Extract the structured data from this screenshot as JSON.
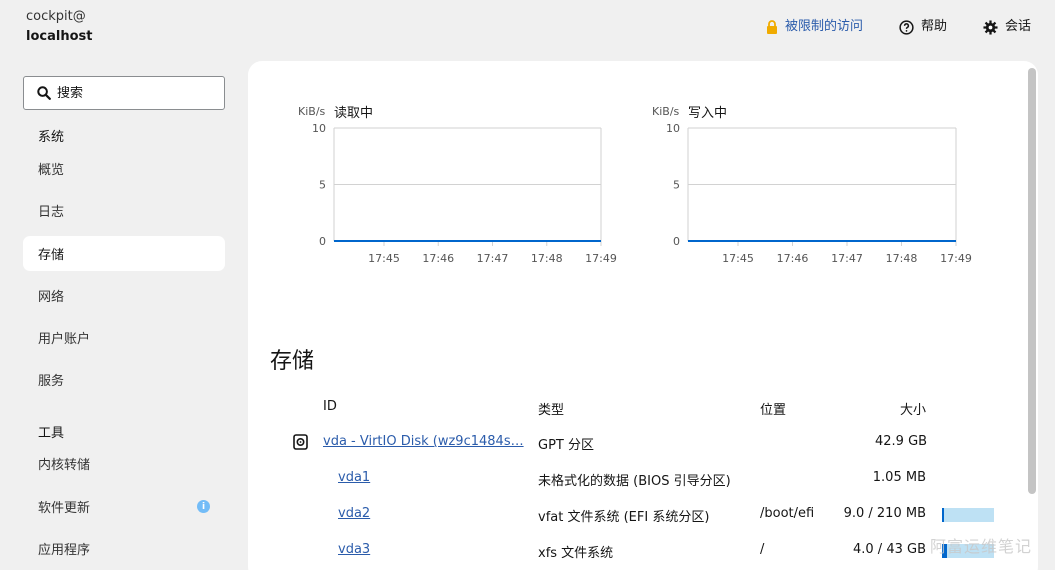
{
  "host": {
    "user": "cockpit@",
    "name": "localhost"
  },
  "topbar": {
    "limited_access": "被限制的访问",
    "help": "帮助",
    "session": "会话",
    "colors": {
      "link": "#2b5cab",
      "lock": "#f0ab00"
    }
  },
  "sidebar": {
    "search_placeholder": "搜索",
    "system_label": "系统",
    "system_items": [
      {
        "label": "概览"
      },
      {
        "label": "日志"
      },
      {
        "label": "存储"
      },
      {
        "label": "网络"
      },
      {
        "label": "用户账户"
      },
      {
        "label": "服务"
      }
    ],
    "tools_label": "工具",
    "tools_items": [
      {
        "label": "内核转储"
      },
      {
        "label": "软件更新"
      },
      {
        "label": "应用程序"
      }
    ],
    "active_item": "存储"
  },
  "charts": {
    "read": {
      "title": "读取中",
      "unit": "KiB/s"
    },
    "write": {
      "title": "写入中",
      "unit": "KiB/s"
    }
  },
  "chart_data": [
    {
      "type": "line",
      "title": "读取中",
      "ylabel": "KiB/s",
      "ylim": [
        0,
        10
      ],
      "y_ticks": [
        "10",
        "5",
        "0"
      ],
      "x": [
        "17:45",
        "17:46",
        "17:47",
        "17:48",
        "17:49"
      ],
      "values": [
        0,
        0,
        0,
        0,
        0
      ],
      "grid": true,
      "line_color": "#0066cc"
    },
    {
      "type": "line",
      "title": "写入中",
      "ylabel": "KiB/s",
      "ylim": [
        0,
        10
      ],
      "y_ticks": [
        "10",
        "5",
        "0"
      ],
      "x": [
        "17:45",
        "17:46",
        "17:47",
        "17:48",
        "17:49"
      ],
      "values": [
        0,
        0,
        0,
        0,
        0
      ],
      "grid": true,
      "line_color": "#0066cc"
    }
  ],
  "storage": {
    "heading": "存储",
    "columns": {
      "id": "ID",
      "type": "类型",
      "location": "位置",
      "size": "大小"
    },
    "rows": [
      {
        "id": "vda - VirtIO Disk (wz9c1484s…",
        "type": "GPT 分区",
        "location": "",
        "size": "42.9 GB"
      },
      {
        "id": "vda1",
        "type": "未格式化的数据 (BIOS 引导分区)",
        "location": "",
        "size": "1.05 MB"
      },
      {
        "id": "vda2",
        "type": "vfat 文件系统 (EFI 系统分区)",
        "location": "/boot/efi",
        "size": "9.0 / 210 MB",
        "usage": 0.043
      },
      {
        "id": "vda3",
        "type": "xfs 文件系统",
        "location": "/",
        "size": "4.0 / 43 GB",
        "usage": 0.093
      }
    ]
  },
  "watermark": "阿富运维笔记"
}
